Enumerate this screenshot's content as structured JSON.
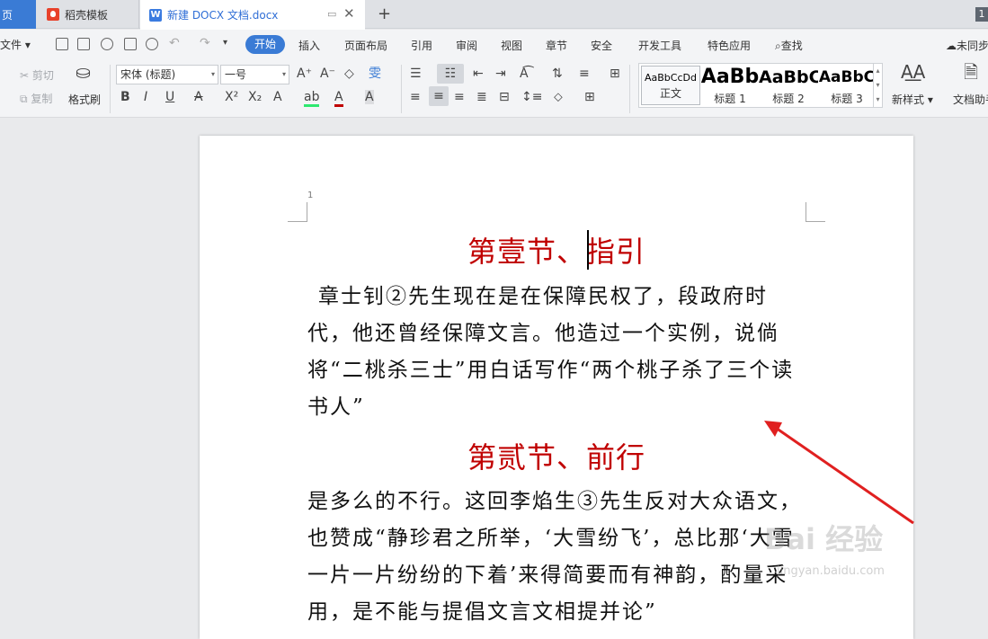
{
  "tabs": {
    "home": "页",
    "docer": "稻壳模板",
    "doc": "新建 DOCX 文档.docx",
    "new_tab": "+",
    "count": "1"
  },
  "menu": {
    "file": "文件",
    "items": [
      "开始",
      "插入",
      "页面布局",
      "引用",
      "审阅",
      "视图",
      "章节",
      "安全",
      "开发工具",
      "特色应用",
      "查找"
    ],
    "sync": "未同步"
  },
  "ribbon": {
    "cut": "剪切",
    "copy": "复制",
    "format_painter": "格式刷",
    "font_name": "宋体 (标题)",
    "font_size": "一号",
    "styles": [
      {
        "preview": "AaBbCcDd",
        "label": "正文"
      },
      {
        "preview": "AaBb",
        "label": "标题 1"
      },
      {
        "preview": "AaBbC",
        "label": "标题 2"
      },
      {
        "preview": "AaBbC",
        "label": "标题 3"
      }
    ],
    "new_style": "新样式",
    "doc_helper": "文档助手"
  },
  "document": {
    "page_number": "1",
    "heading1": "第壹节、指引",
    "para1": "章士钊②先生现在是在保障民权了，段政府时代，他还曾经保障文言。他造过一个实例，说倘将“二桃杀三士”用白话写作“两个桃子杀了三个读书人”",
    "heading2": "第贰节、前行",
    "para2": "是多么的不行。这回李焰生③先生反对大众语文，也赞成“静珍君之所举，‘大雪纷飞’，总比那‘大雪一片一片纷纷的下着’来得简要而有神韵，酌量采用，是不能与提倡文言文相提并论”"
  },
  "watermark": {
    "main": "Bai 经验",
    "sub": "jingyan.baidu.com"
  },
  "colors": {
    "accent": "#3a7bd5",
    "heading": "#c00000",
    "arrow": "#e02020"
  }
}
